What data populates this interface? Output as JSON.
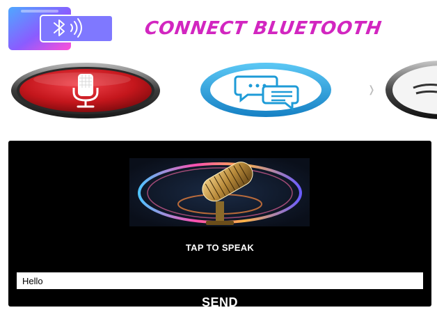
{
  "header": {
    "title": "CONNECT BLUETOOTH",
    "logo_icon": "bluetooth-phone-icon",
    "title_color": "#d226c0"
  },
  "modes": [
    {
      "icon": "microphone-icon",
      "color": "#c4161c"
    },
    {
      "icon": "chat-bubbles-icon",
      "color": "#1e9bd7"
    },
    {
      "icon": "partial-round-icon",
      "color": "#444444"
    }
  ],
  "panel": {
    "image_icon": "neon-microphone-icon",
    "tap_label": "TAP TO SPEAK",
    "input_value": "Hello",
    "send_label": "SEND",
    "background": "#000000"
  }
}
